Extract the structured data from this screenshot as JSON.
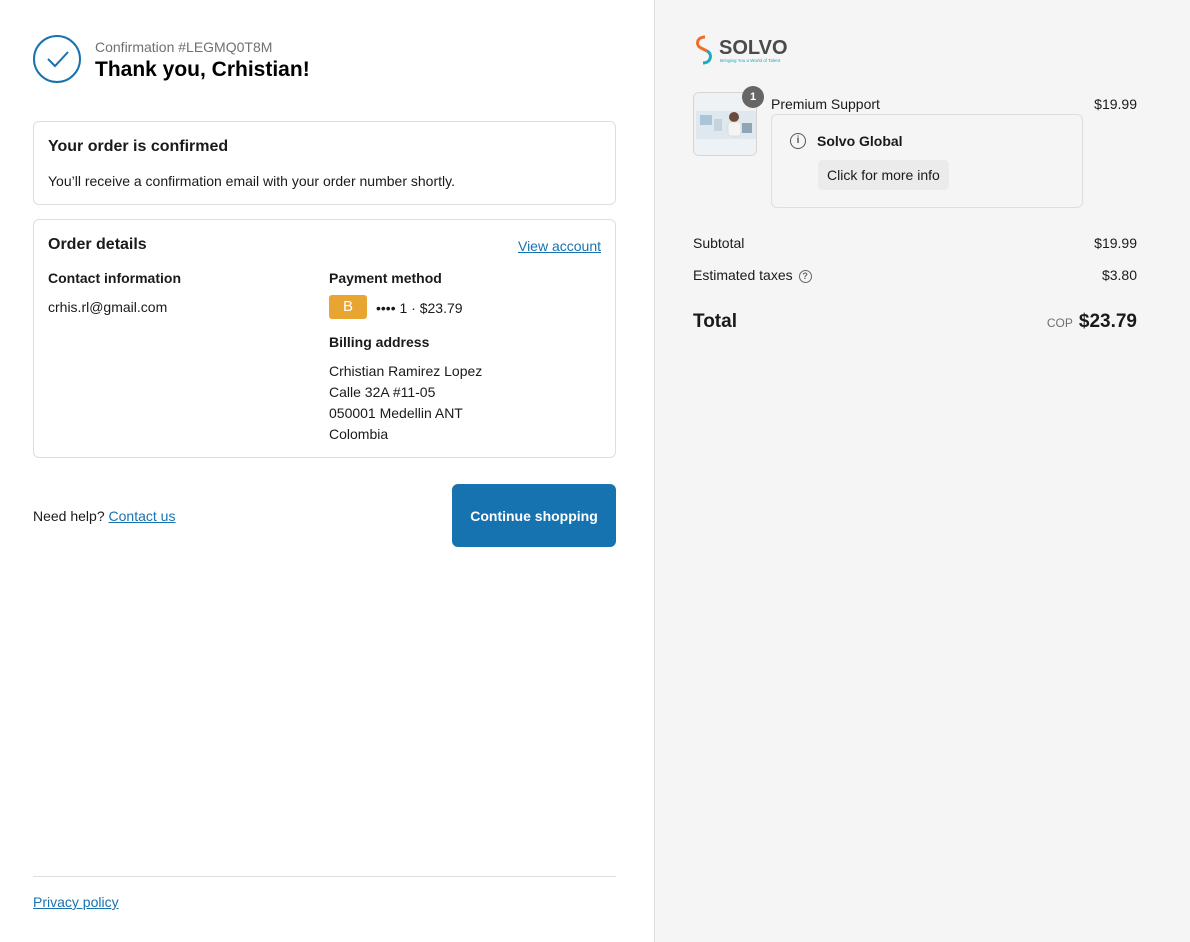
{
  "header": {
    "confirmation": "Confirmation #LEGMQ0T8M",
    "thanks": "Thank you, Crhistian!"
  },
  "confirmed_box": {
    "title": "Your order is confirmed",
    "text": "You’ll receive a confirmation email with your order number shortly."
  },
  "order_details": {
    "title": "Order details",
    "view_account": "View account",
    "contact_label": "Contact information",
    "contact_email": "crhis.rl@gmail.com",
    "payment_label": "Payment method",
    "payment_badge": "B",
    "payment_text": "•••• 1 · $23.79",
    "billing_label": "Billing address",
    "billing_lines": [
      "Crhistian Ramirez Lopez",
      "Calle 32A #11-05",
      "050001 Medellin ANT",
      "Colombia"
    ]
  },
  "help": {
    "text": "Need help?",
    "link": "Contact us"
  },
  "continue_button": "Continue shopping",
  "footer": {
    "privacy": "Privacy policy"
  },
  "summary": {
    "logo_text": "SOLVO",
    "logo_tagline": "Bringing You a World of Talent",
    "item": {
      "quantity": "1",
      "name": "Premium Support",
      "price": "$19.99",
      "info_title": "Solvo Global",
      "info_button": "Click for more info"
    },
    "subtotal_label": "Subtotal",
    "subtotal_value": "$19.99",
    "taxes_label": "Estimated taxes",
    "taxes_value": "$3.80",
    "total_label": "Total",
    "total_currency": "COP",
    "total_value": "$23.79"
  },
  "colors": {
    "accent": "#1773b0",
    "badge": "#e8a532",
    "sidebar_bg": "#f5f5f5"
  }
}
